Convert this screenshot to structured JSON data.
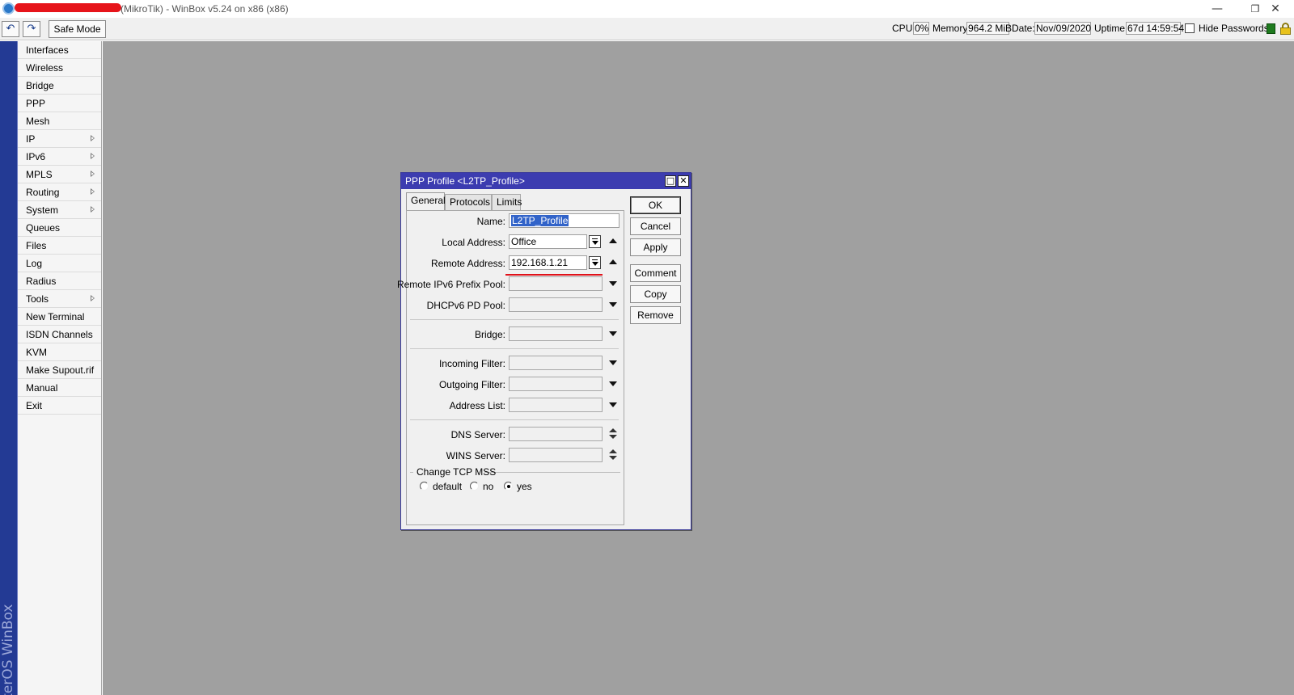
{
  "window": {
    "title": "(MikroTik) - WinBox v5.24 on x86 (x86)",
    "minimize": "—",
    "maximize": "❐",
    "close": "✕"
  },
  "toolbar": {
    "undo_icon": "undo-icon",
    "redo_icon": "redo-icon",
    "undo_glyph": "↶",
    "redo_glyph": "↷",
    "safe_mode": "Safe Mode",
    "cpu_label": "CPU:",
    "cpu_value": "0%",
    "memory_label": "Memory:",
    "memory_value": "964.2 MiB",
    "date_label": "Date:",
    "date_value": "Nov/09/2020",
    "uptime_label": "Uptime:",
    "uptime_value": "67d 14:59:54",
    "hide_passwords_label": "Hide Passwords",
    "hide_passwords_checked": false
  },
  "brand": "RouterOS WinBox",
  "menu": [
    {
      "label": "Interfaces",
      "submenu": false
    },
    {
      "label": "Wireless",
      "submenu": false
    },
    {
      "label": "Bridge",
      "submenu": false
    },
    {
      "label": "PPP",
      "submenu": false
    },
    {
      "label": "Mesh",
      "submenu": false
    },
    {
      "label": "IP",
      "submenu": true
    },
    {
      "label": "IPv6",
      "submenu": true
    },
    {
      "label": "MPLS",
      "submenu": true
    },
    {
      "label": "Routing",
      "submenu": true
    },
    {
      "label": "System",
      "submenu": true
    },
    {
      "label": "Queues",
      "submenu": false
    },
    {
      "label": "Files",
      "submenu": false
    },
    {
      "label": "Log",
      "submenu": false
    },
    {
      "label": "Radius",
      "submenu": false
    },
    {
      "label": "Tools",
      "submenu": true
    },
    {
      "label": "New Terminal",
      "submenu": false
    },
    {
      "label": "ISDN Channels",
      "submenu": false
    },
    {
      "label": "KVM",
      "submenu": false
    },
    {
      "label": "Make Supout.rif",
      "submenu": false
    },
    {
      "label": "Manual",
      "submenu": false
    },
    {
      "label": "Exit",
      "submenu": false
    }
  ],
  "dialog": {
    "title": "PPP Profile <L2TP_Profile>",
    "tabs": [
      "General",
      "Protocols",
      "Limits"
    ],
    "active_tab": "General",
    "fields": {
      "name": {
        "label": "Name:",
        "value": "L2TP_Profile"
      },
      "local_address": {
        "label": "Local Address:",
        "value": "Office"
      },
      "remote_address": {
        "label": "Remote Address:",
        "value": "192.168.1.21"
      },
      "remote_ipv6_prefix_pool": {
        "label": "Remote IPv6 Prefix Pool:",
        "value": ""
      },
      "dhcpv6_pd_pool": {
        "label": "DHCPv6 PD Pool:",
        "value": ""
      },
      "bridge": {
        "label": "Bridge:",
        "value": ""
      },
      "incoming_filter": {
        "label": "Incoming Filter:",
        "value": ""
      },
      "outgoing_filter": {
        "label": "Outgoing Filter:",
        "value": ""
      },
      "address_list": {
        "label": "Address List:",
        "value": ""
      },
      "dns_server": {
        "label": "DNS Server:",
        "value": ""
      },
      "wins_server": {
        "label": "WINS Server:",
        "value": ""
      }
    },
    "change_tcp_mss": {
      "label": "Change TCP MSS",
      "options": [
        "default",
        "no",
        "yes"
      ],
      "selected": "yes"
    },
    "buttons": {
      "ok": "OK",
      "cancel": "Cancel",
      "apply": "Apply",
      "comment": "Comment",
      "copy": "Copy",
      "remove": "Remove"
    },
    "title_controls": {
      "restore": "□",
      "close": "✕"
    }
  },
  "colors": {
    "brand_strip": "#233a94",
    "dialog_title": "#3c3cb0",
    "workspace": "#a0a0a0",
    "highlight_underline": "#e0121a"
  }
}
